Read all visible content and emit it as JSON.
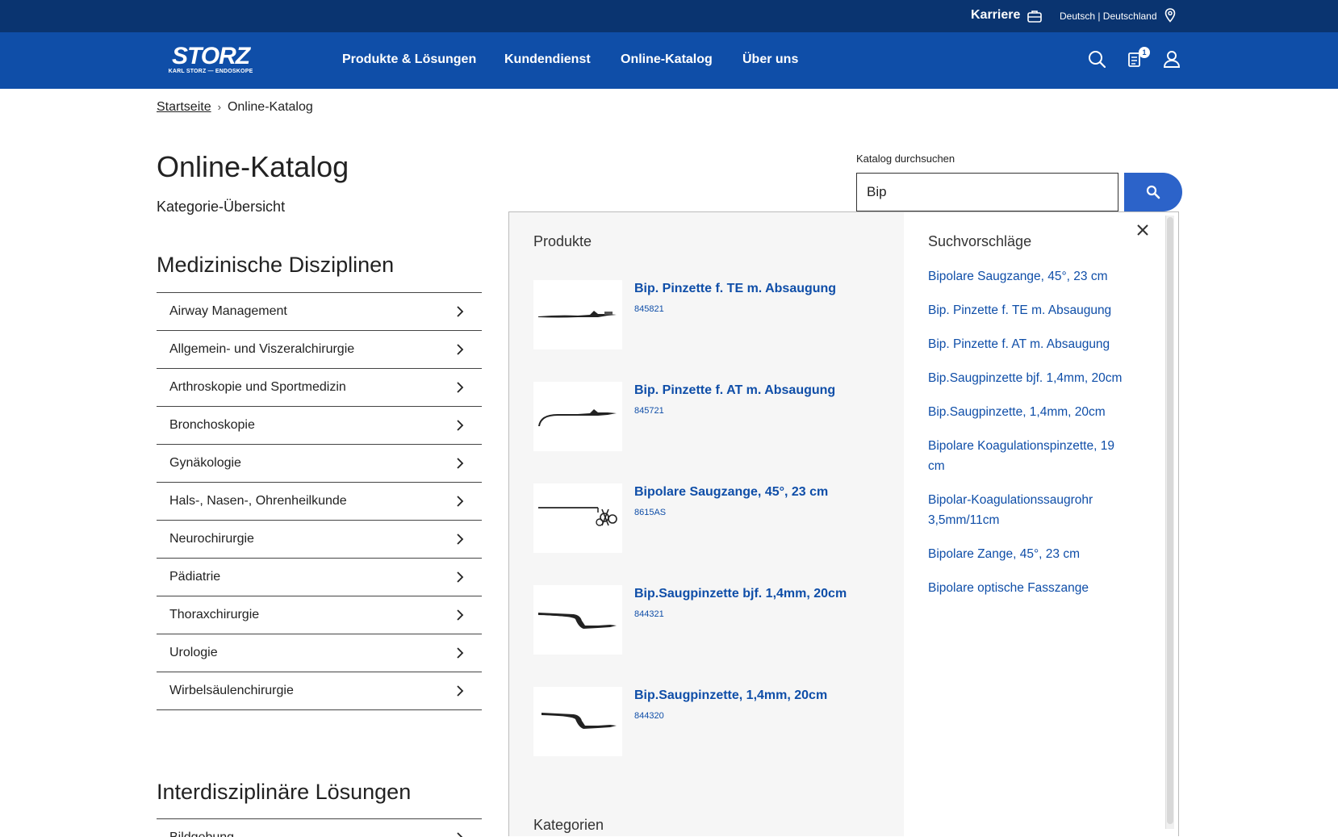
{
  "topbar": {
    "karriere": "Karriere",
    "language": "Deutsch | Deutschland"
  },
  "brand": {
    "logo_big": "STORZ",
    "logo_small": "KARL STORZ — ENDOSKOPE"
  },
  "nav": {
    "items": [
      "Produkte & Lösungen",
      "Kundendienst",
      "Online-Katalog",
      "Über uns"
    ],
    "cart_badge": "1"
  },
  "breadcrumb": {
    "home": "Startseite",
    "separator": "›",
    "current": "Online-Katalog"
  },
  "page": {
    "title": "Online-Katalog",
    "subtitle": "Kategorie-Übersicht"
  },
  "disciplines": {
    "title": "Medizinische Disziplinen",
    "items": [
      "Airway Management",
      "Allgemein- und Viszeralchirurgie",
      "Arthroskopie und Sportmedizin",
      "Bronchoskopie",
      "Gynäkologie",
      "Hals-, Nasen-, Ohrenheilkunde",
      "Neurochirurgie",
      "Pädiatrie",
      "Thoraxchirurgie",
      "Urologie",
      "Wirbelsäulenchirurgie"
    ]
  },
  "interdisciplinary": {
    "title": "Interdisziplinäre Lösungen",
    "first_item": "Bildgebung"
  },
  "search": {
    "label": "Katalog durchsuchen",
    "value": "Bip"
  },
  "dropdown": {
    "products_title": "Produkte",
    "products": [
      {
        "name": "Bip. Pinzette f. TE m. Absaugung",
        "code": "845821"
      },
      {
        "name": "Bip. Pinzette f. AT m. Absaugung",
        "code": "845721"
      },
      {
        "name": "Bipolare Saugzange, 45°, 23 cm",
        "code": "8615AS"
      },
      {
        "name": "Bip.Saugpinzette bjf. 1,4mm, 20cm",
        "code": "844321"
      },
      {
        "name": "Bip.Saugpinzette, 1,4mm, 20cm",
        "code": "844320"
      }
    ],
    "categories_title": "Kategorien",
    "suggestions_title": "Suchvorschläge",
    "suggestions": [
      "Bipolare Saugzange, 45°, 23 cm",
      "Bip. Pinzette f. TE m. Absaugung",
      "Bip. Pinzette f. AT m. Absaugung",
      "Bip.Saugpinzette bjf. 1,4mm, 20cm",
      "Bip.Saugpinzette, 1,4mm, 20cm",
      "Bipolare Koagulationspinzette, 19 cm",
      "Bipolar-Koagulationssaugrohr 3,5mm/11cm",
      "Bipolare Zange, 45°, 23 cm",
      "Bipolare optische Fasszange"
    ]
  },
  "colors": {
    "topbar": "#0a3470",
    "navbar": "#0f4ea8",
    "link": "#0f4ea8",
    "search_button": "#2c63c9"
  }
}
